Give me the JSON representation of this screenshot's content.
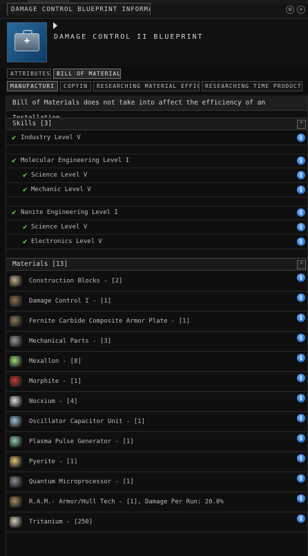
{
  "window": {
    "title": "DAMAGE CONTROL BLUEPRINT INFORMATION",
    "icons": [
      "settings-icon",
      "close-icon"
    ]
  },
  "item": {
    "name": "DAMAGE CONTROL II BLUEPRINT",
    "icon": "medkit-case-icon"
  },
  "tabs_row1": [
    "ATTRIBUTES",
    "BILL OF MATERIALS"
  ],
  "tabs_row2": [
    "MANUFACTURI",
    "COPYIN",
    "RESEARCHING MATERIAL EFFICIE",
    "RESEARCHING TIME PRODUCTI"
  ],
  "note": "Bill of Materials does not take into affect the efficiency of an Installation",
  "skills": {
    "header": "Skills [3]",
    "groups": [
      {
        "label": "Industry Level V",
        "subs": []
      },
      {
        "label": "Molecular Engineering Level I",
        "subs": [
          "Science Level V",
          "Mechanic Level V"
        ]
      },
      {
        "label": "Nanite Engineering Level I",
        "subs": [
          "Science Level V",
          "Electronics Level V"
        ]
      }
    ]
  },
  "materials": {
    "header": "Materials [13]",
    "items": [
      {
        "label": "Construction Blocks - [2]",
        "icon": "construction-blocks-icon",
        "color": "#c9b08a"
      },
      {
        "label": "Damage Control I - [1]",
        "icon": "damage-control-icon",
        "color": "#8a7350"
      },
      {
        "label": "Fernite Carbide Composite Armor Plate - [1]",
        "icon": "armor-plate-icon",
        "color": "#8d7a5a"
      },
      {
        "label": "Mechanical Parts - [3]",
        "icon": "mechanical-parts-icon",
        "color": "#9a9a9a"
      },
      {
        "label": "Mexallon - [8]",
        "icon": "mexallon-icon",
        "color": "#9be07a"
      },
      {
        "label": "Morphite - [1]",
        "icon": "morphite-icon",
        "color": "#c23b3b"
      },
      {
        "label": "Nocxium - [4]",
        "icon": "nocxium-icon",
        "color": "#e0e0e0"
      },
      {
        "label": "Oscillator Capacitor Unit - [1]",
        "icon": "capacitor-unit-icon",
        "color": "#9fc3d6"
      },
      {
        "label": "Plasma Pulse Generator - [1]",
        "icon": "pulse-generator-icon",
        "color": "#8fd0a8"
      },
      {
        "label": "Pyerite - [1]",
        "icon": "pyerite-icon",
        "color": "#e3c27a"
      },
      {
        "label": "Quantum Microprocessor - [1]",
        "icon": "microprocessor-icon",
        "color": "#8a8f99"
      },
      {
        "label": "R.A.M.- Armor/Hull Tech - [1], Damage Per Run: 20.0%",
        "icon": "ram-tech-icon",
        "color": "#a68a5a"
      },
      {
        "label": "Tritanium - [250]",
        "icon": "tritanium-icon",
        "color": "#d8cfb5"
      }
    ]
  }
}
